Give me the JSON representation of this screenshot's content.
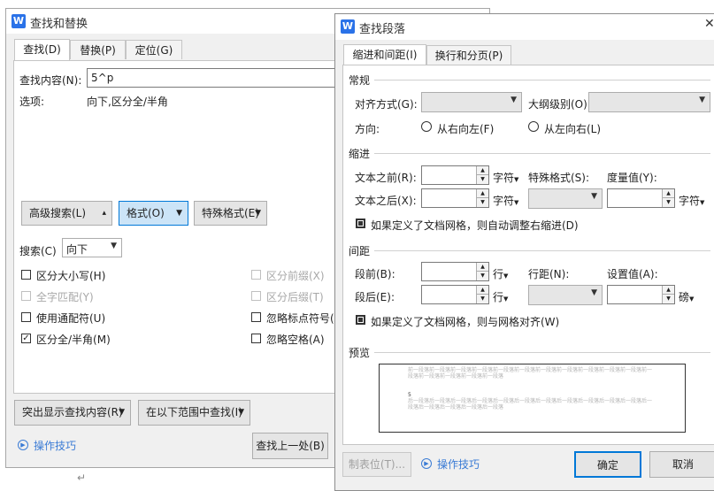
{
  "find_dialog": {
    "title": "查找和替换",
    "tabs": [
      "查找(D)",
      "替换(P)",
      "定位(G)"
    ],
    "find_label": "查找内容(N):",
    "find_value": "5^p",
    "options_label": "选项:",
    "options_value": "向下,区分全/半角",
    "advanced_button": "高级搜索(L)",
    "format_button": "格式(O)",
    "special_button": "特殊格式(E)",
    "search_label": "搜索(C)",
    "search_value": "向下",
    "checks_left": [
      {
        "label": "区分大小写(H)",
        "checked": false,
        "enabled": true
      },
      {
        "label": "全字匹配(Y)",
        "checked": false,
        "enabled": false
      },
      {
        "label": "使用通配符(U)",
        "checked": false,
        "enabled": true
      },
      {
        "label": "区分全/半角(M)",
        "checked": true,
        "enabled": true
      }
    ],
    "checks_right": [
      {
        "label": "区分前缀(X)",
        "checked": false,
        "enabled": false
      },
      {
        "label": "区分后缀(T)",
        "checked": false,
        "enabled": false
      },
      {
        "label": "忽略标点符号(",
        "checked": false,
        "enabled": true
      },
      {
        "label": "忽略空格(A)",
        "checked": false,
        "enabled": true
      }
    ],
    "highlight_button": "突出显示查找内容(R)",
    "range_button": "在以下范围中查找(I)",
    "tips_link": "操作技巧",
    "find_prev_button": "查找上一处(B)"
  },
  "para_dialog": {
    "title": "查找段落",
    "tabs": [
      "缩进和间距(I)",
      "换行和分页(P)"
    ],
    "general": "常规",
    "align_label": "对齐方式(G):",
    "outline_label": "大纲级别(O):",
    "direction_label": "方向:",
    "rtl_label": "从右向左(F)",
    "ltr_label": "从左向右(L)",
    "indent": "缩进",
    "before_text_label": "文本之前(R):",
    "after_text_label": "文本之后(X):",
    "unit_chars": "字符",
    "special_label": "特殊格式(S):",
    "measure_label": "度量值(Y):",
    "auto_indent_check": "如果定义了文档网格，则自动调整右缩进(D)",
    "spacing": "间距",
    "before_para_label": "段前(B):",
    "after_para_label": "段后(E):",
    "unit_lines": "行",
    "line_spacing_label": "行距(N):",
    "set_value_label": "设置值(A):",
    "unit_pounds": "磅",
    "grid_align_check": "如果定义了文档网格，则与网格对齐(W)",
    "preview": "预览",
    "preview_before": "前一段落前一段落前一段落前一段落前一段落前一段落前一段落前一段落前一段落前一段落前一段落前一段落前一段落前一段落前一段落前一段落",
    "preview_sample": "5",
    "preview_after": "后一段落后一段落后一段落后一段落后一段落后一段落后一段落后一段落后一段落后一段落后一段落后一段落后一段落后一段落后一段落后一段落",
    "tab_stops_button": "制表位(T)...",
    "tips_link": "操作技巧",
    "ok_button": "确定",
    "cancel_button": "取消"
  },
  "doc_mark": "↵"
}
